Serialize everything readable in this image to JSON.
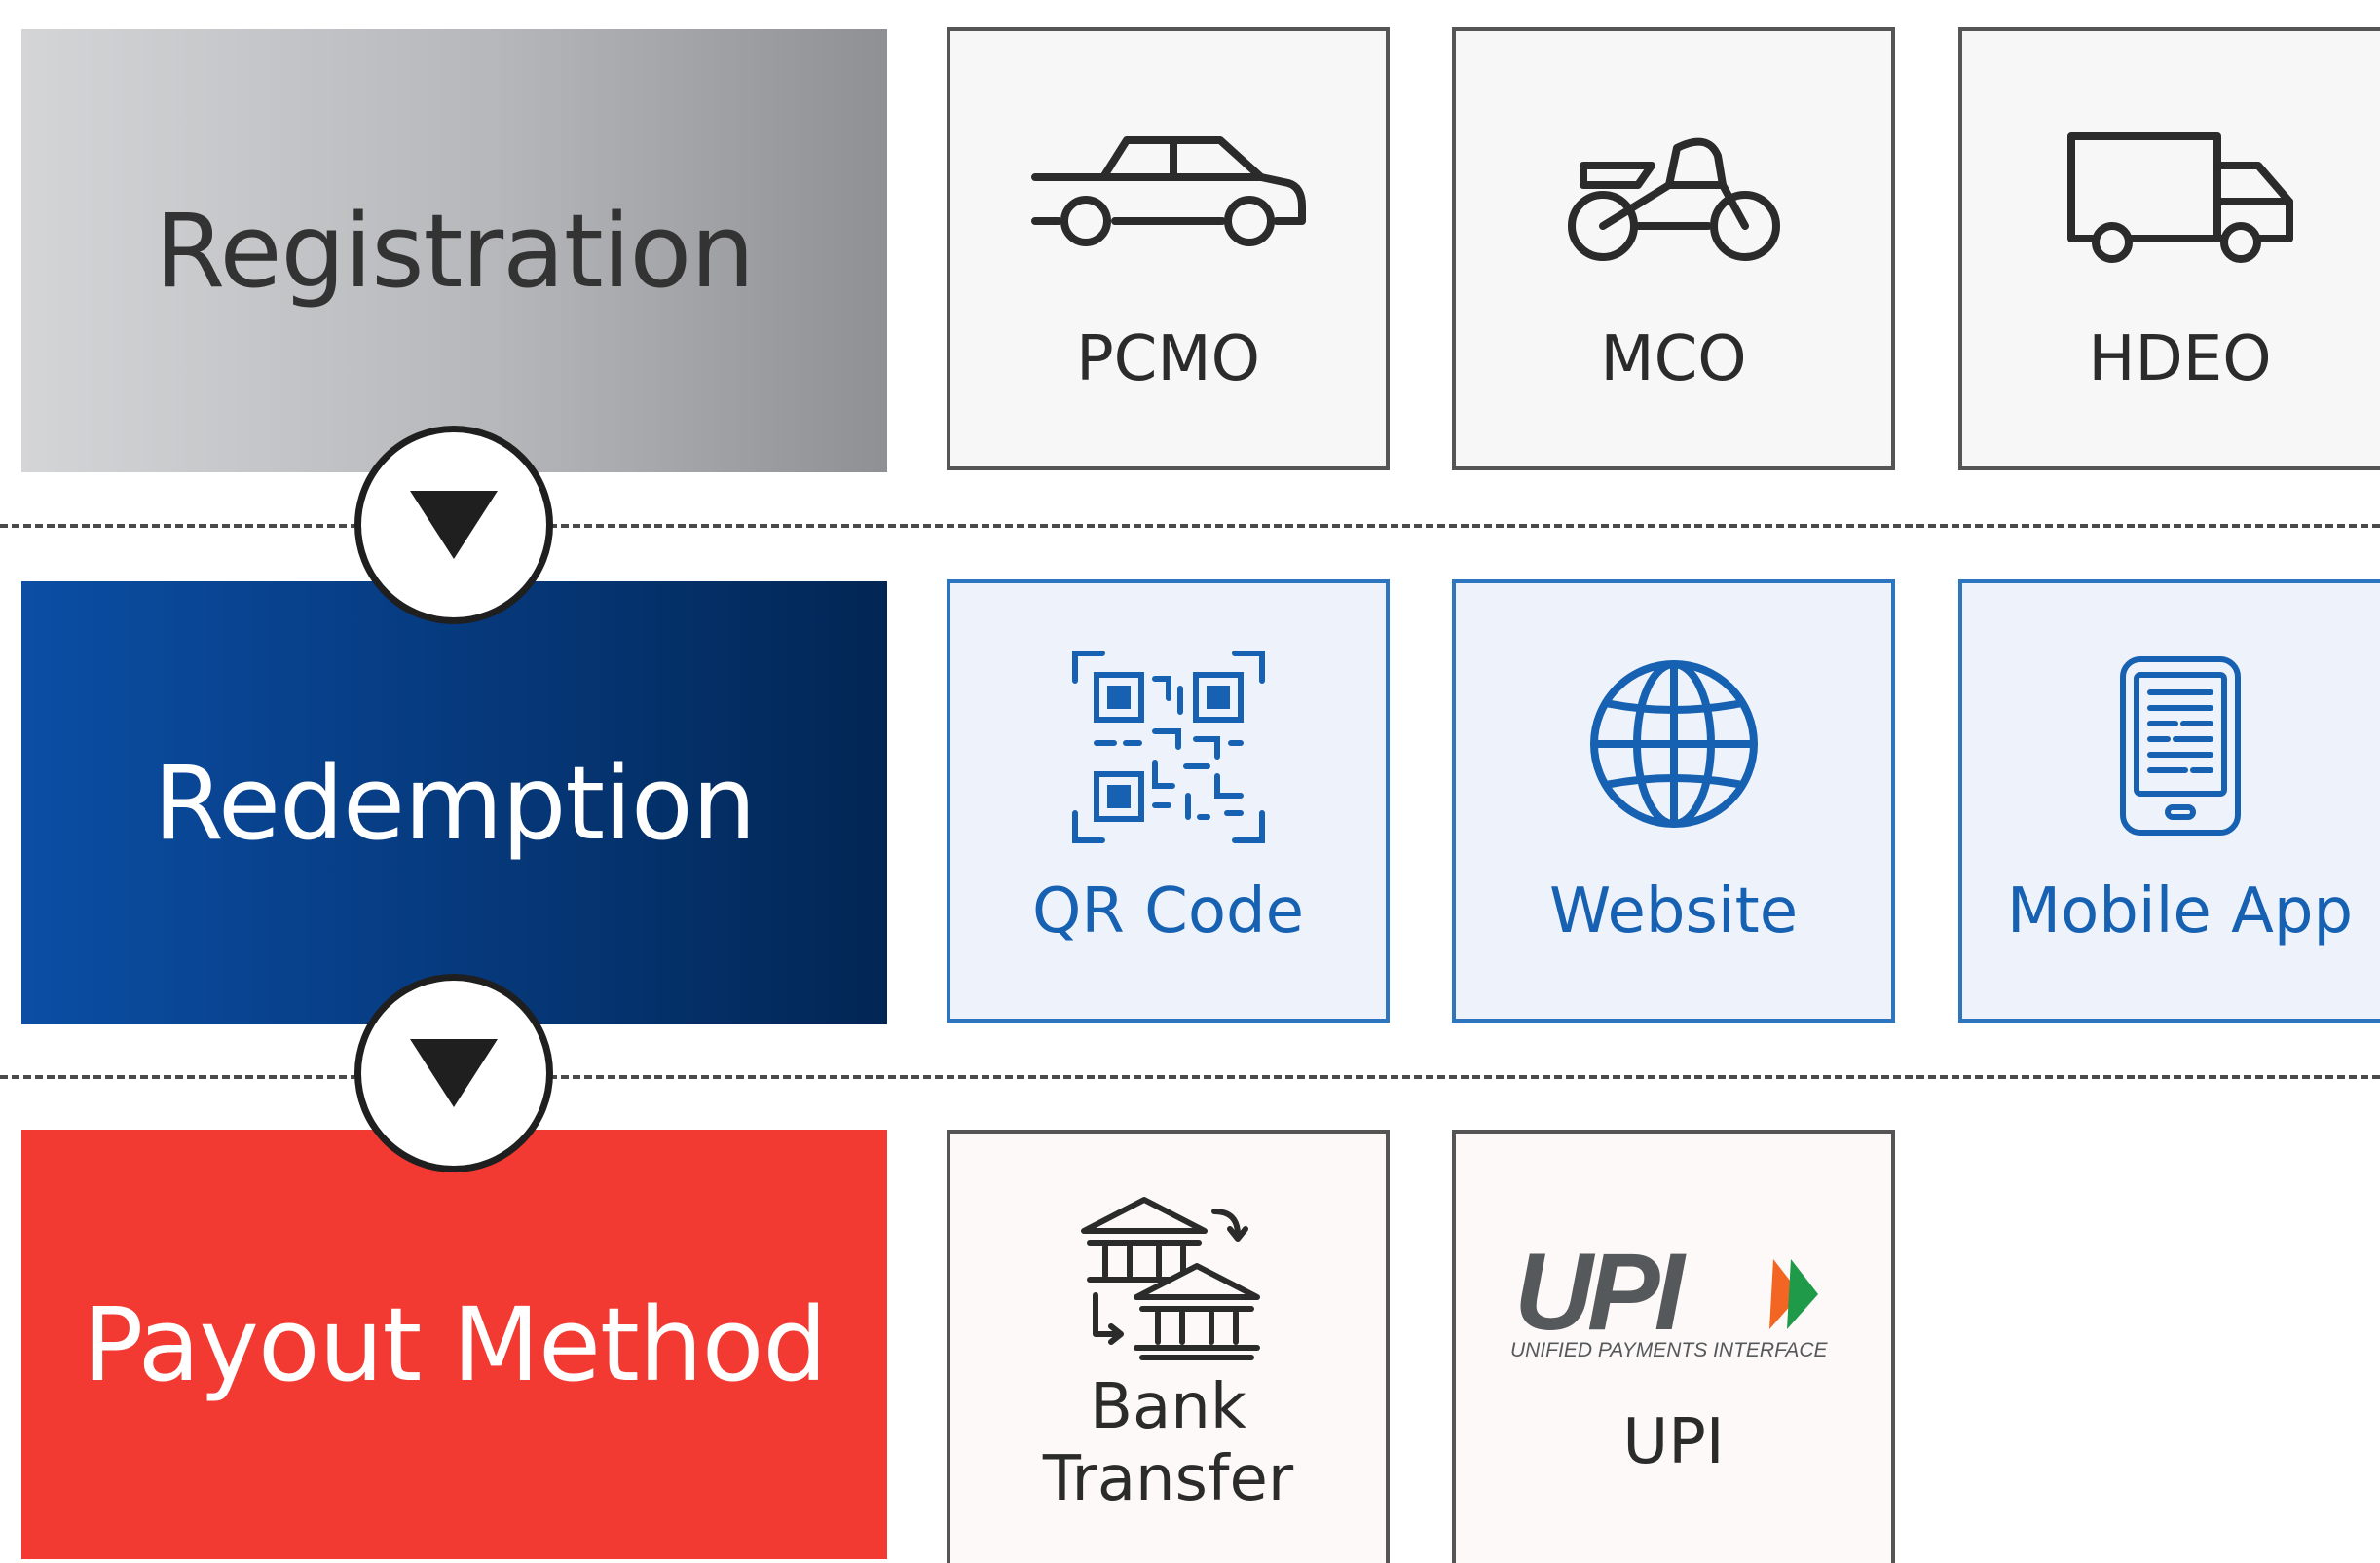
{
  "stages": {
    "registration": "Registration",
    "redemption": "Redemption",
    "payout": "Payout Method"
  },
  "registration_options": [
    {
      "label": "PCMO",
      "icon": "car-icon"
    },
    {
      "label": "MCO",
      "icon": "motorcycle-icon"
    },
    {
      "label": "HDEO",
      "icon": "truck-icon"
    }
  ],
  "redemption_options": [
    {
      "label": "QR Code",
      "icon": "qr-code-icon"
    },
    {
      "label": "Website",
      "icon": "globe-icon"
    },
    {
      "label": "Mobile App",
      "icon": "mobile-phone-icon"
    }
  ],
  "payout_options": [
    {
      "label_line1": "Bank",
      "label_line2": "Transfer",
      "icon": "bank-transfer-icon"
    },
    {
      "label": "UPI",
      "icon": "upi-logo",
      "logo_text": "UPI",
      "logo_subtext": "UNIFIED PAYMENTS INTERFACE"
    }
  ],
  "colors": {
    "registration": "#b6b7ba",
    "redemption": "#073e86",
    "payout": "#f23a33",
    "redemption_accent": "#1761b3"
  }
}
